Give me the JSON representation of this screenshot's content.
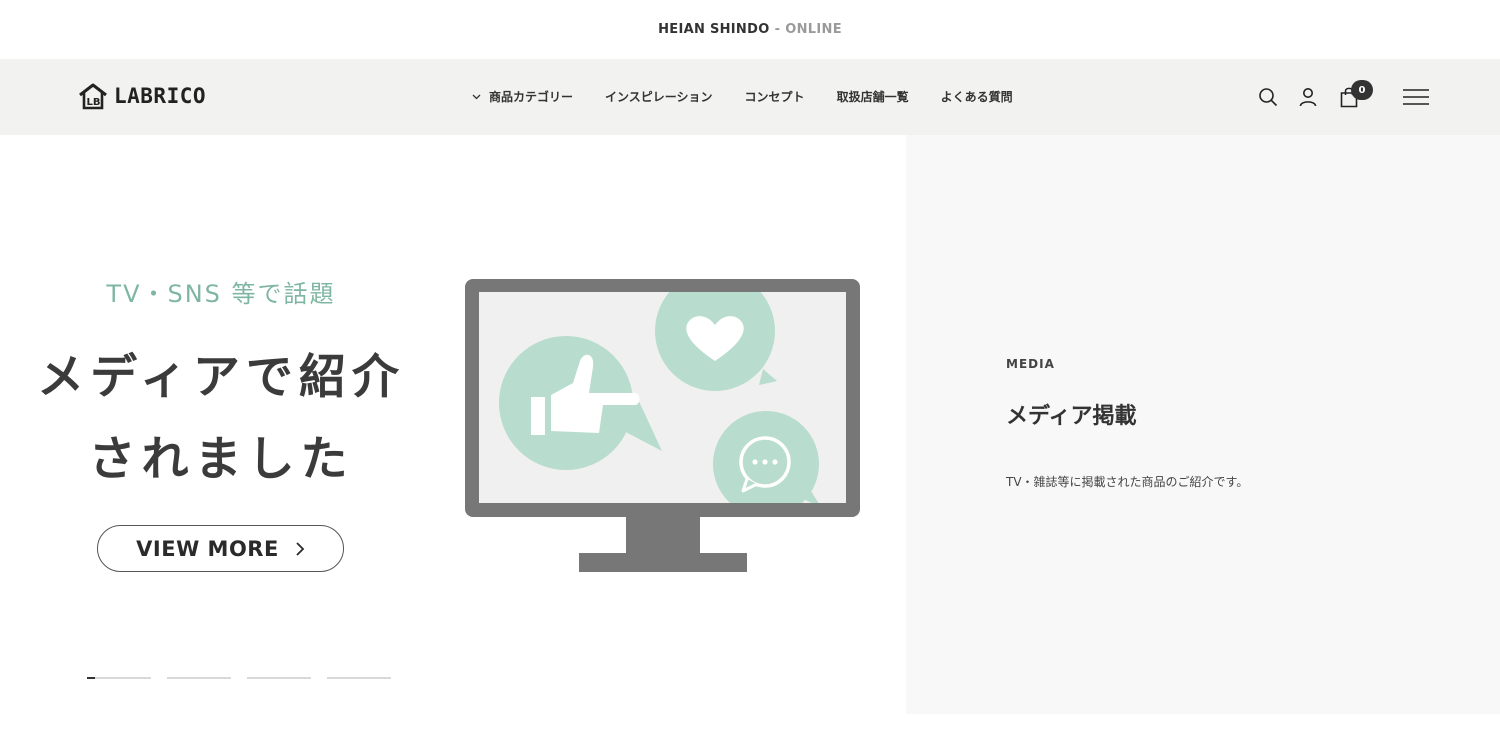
{
  "announcement": {
    "brand": "HEIAN SHINDO",
    "separator": "-",
    "suffix": "ONLINE"
  },
  "header": {
    "logo_text": "LABRICO",
    "logo_monogram": "LB",
    "nav": [
      {
        "label": "商品カテゴリー",
        "has_dropdown": true
      },
      {
        "label": "インスピレーション"
      },
      {
        "label": "コンセプト"
      },
      {
        "label": "取扱店舗一覧"
      },
      {
        "label": "よくある質問"
      }
    ],
    "icons": [
      "search-icon",
      "account-icon",
      "cart-icon",
      "menu-icon"
    ],
    "cart_count": "0"
  },
  "slide": {
    "eyebrow": "TV・SNS 等で話題",
    "headline_line1": "メディアで紹介",
    "headline_line2": "されました",
    "button_label": "VIEW MORE",
    "illustration": "monitor-with-social-icons",
    "indicator_count": 4,
    "active_indicator": 1
  },
  "side_panel": {
    "label": "MEDIA",
    "title": "メディア掲載",
    "description": "TV・雑誌等に掲載された商品のご紹介です。"
  },
  "colors": {
    "accent_green": "#7fb6a2",
    "bubble_green": "#b8dccd",
    "header_bg": "#f2f2f0",
    "side_bg": "#f8f8f8",
    "monitor_gray": "#777777"
  }
}
